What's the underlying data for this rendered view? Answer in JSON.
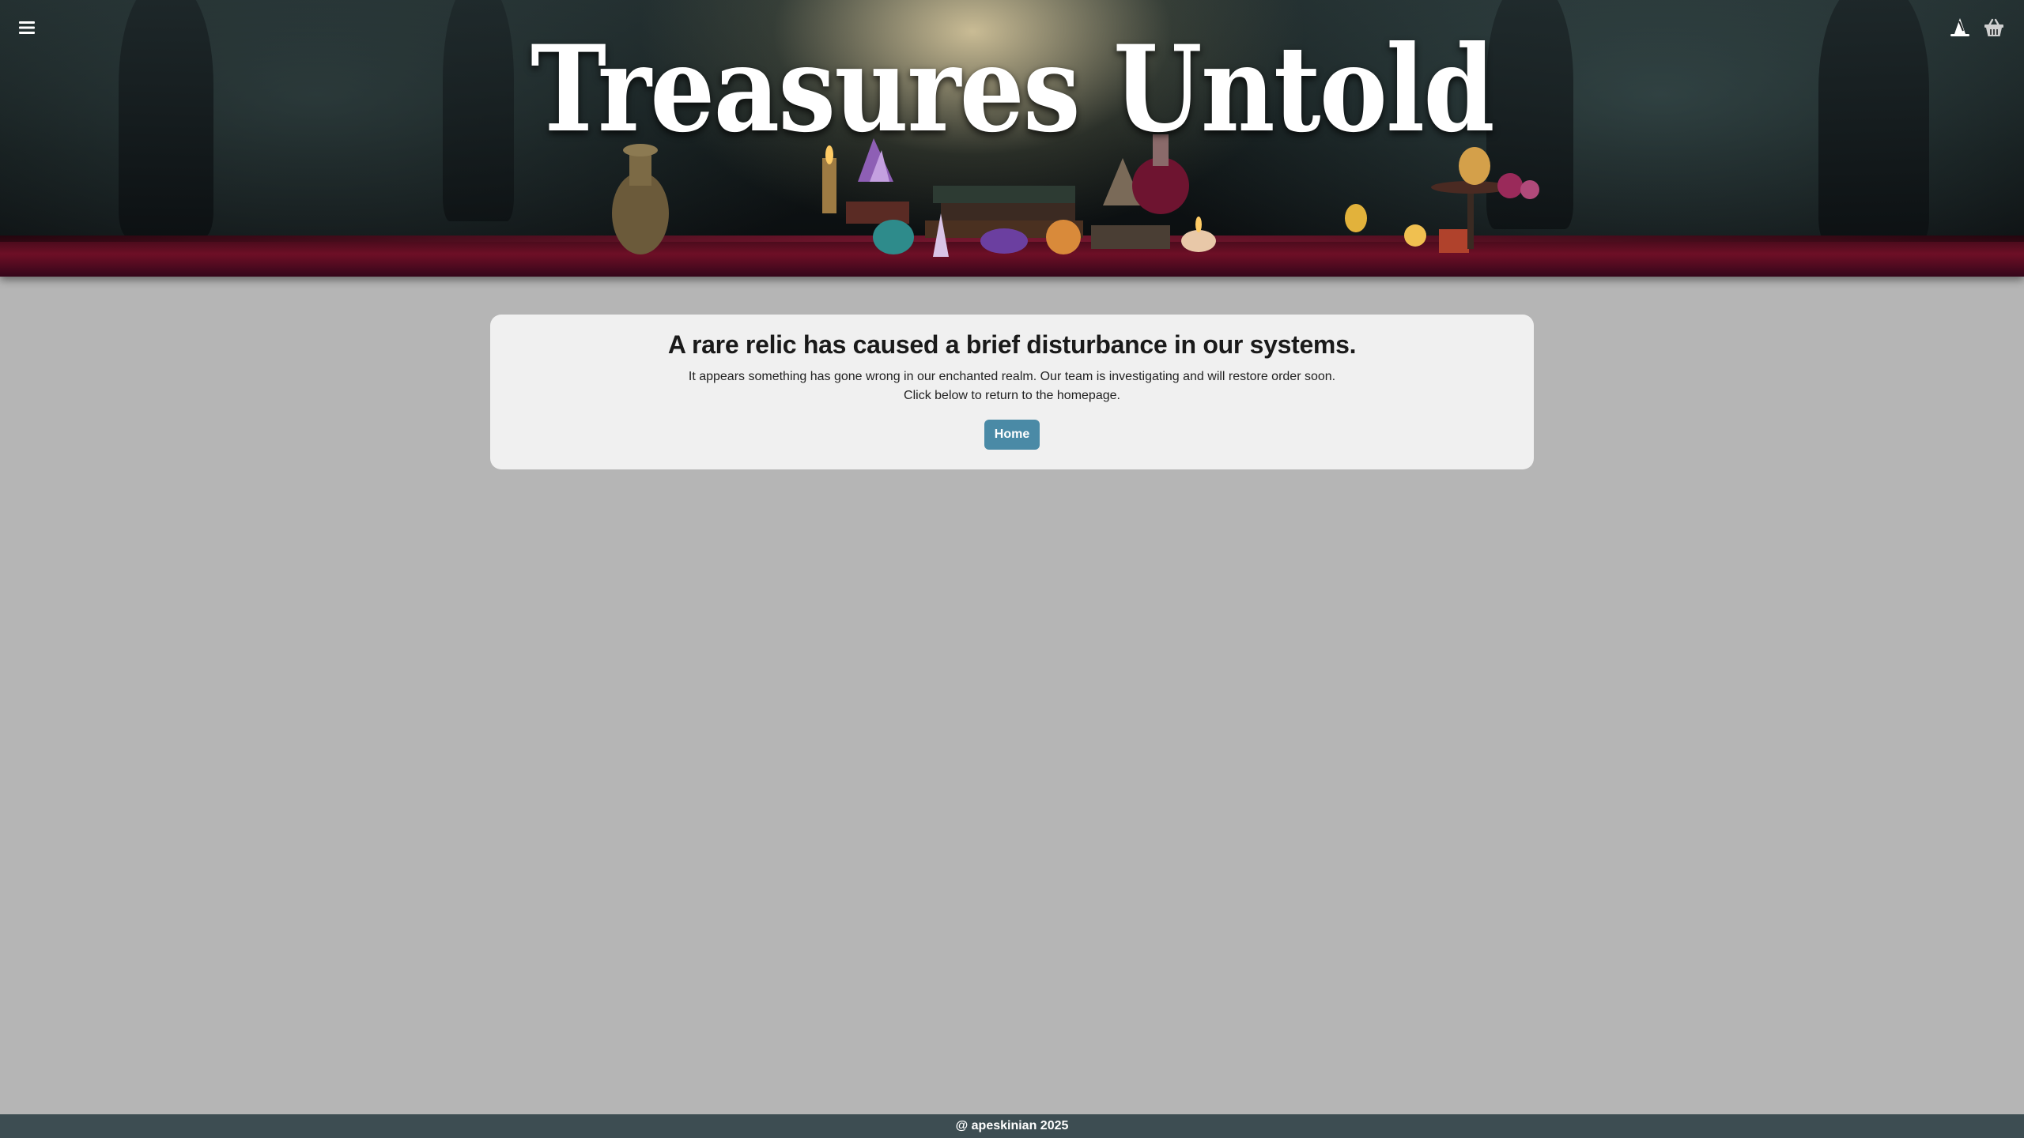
{
  "header": {
    "site_title": "Treasures Untold",
    "menu_icon": "hamburger-menu-icon",
    "account_icon": "wizard-hat-icon",
    "cart_icon": "basket-icon"
  },
  "error": {
    "heading": "A rare relic has caused a brief disturbance in our systems.",
    "message_line1": "It appears something has gone wrong in our enchanted realm. Our team is investigating and will restore order soon.",
    "message_line2": "Click below to return to the homepage.",
    "home_button_label": "Home"
  },
  "footer": {
    "text": "@ apeskinian 2025"
  },
  "colors": {
    "page_background": "#b5b5b5",
    "card_background": "#f0f0f0",
    "button": "#4a8aa6",
    "footer": "#3d4d52"
  }
}
